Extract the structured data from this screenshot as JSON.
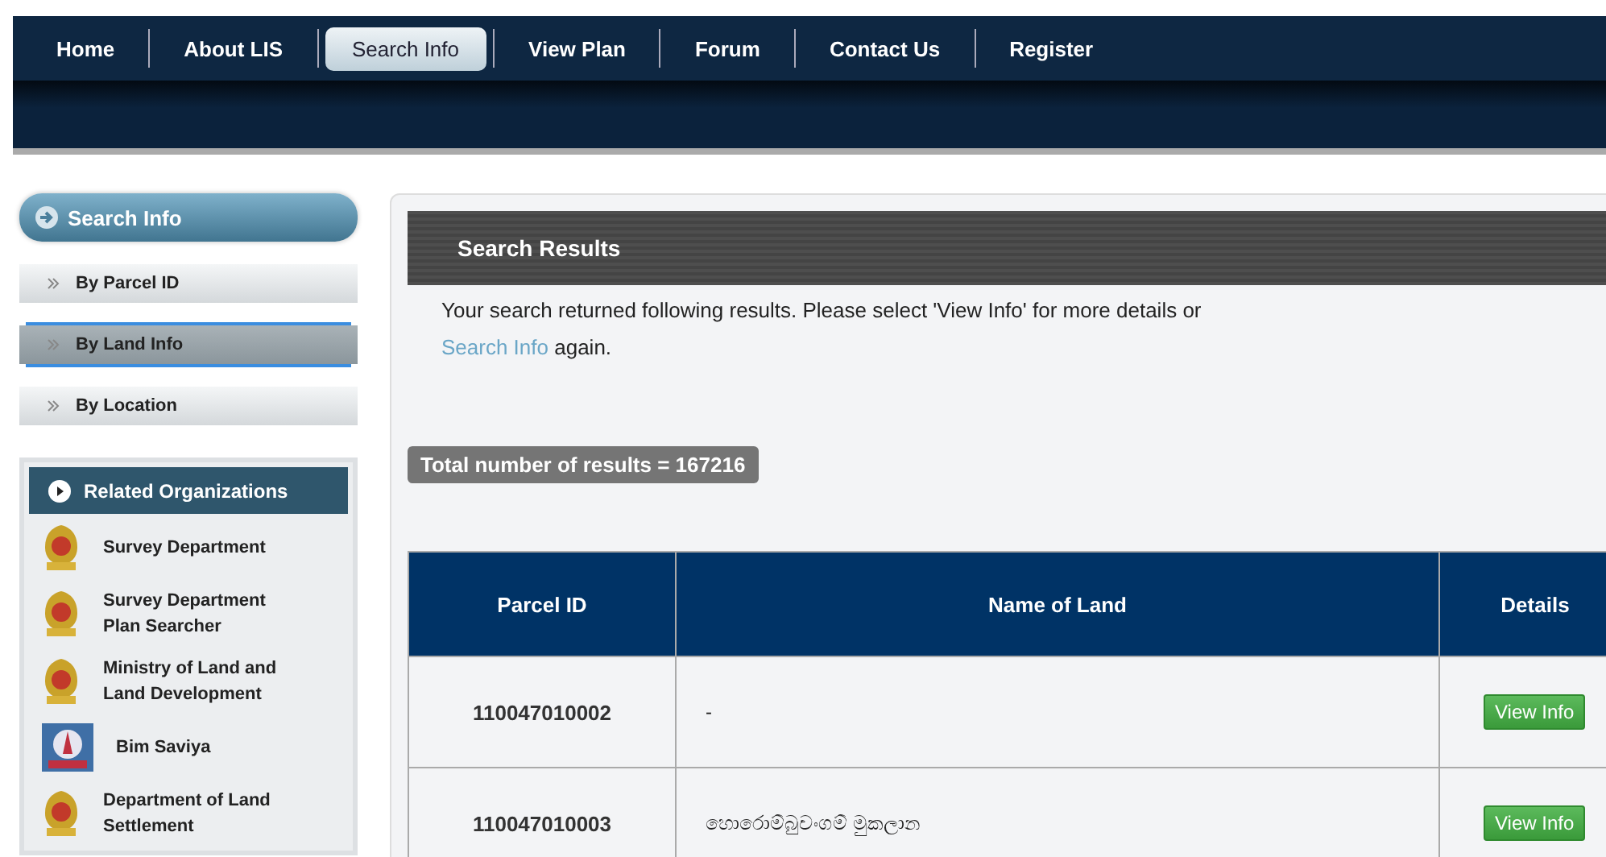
{
  "nav": [
    {
      "label": "Home",
      "selected": false
    },
    {
      "label": "About LIS",
      "selected": false
    },
    {
      "label": "Search Info",
      "selected": true
    },
    {
      "label": "View Plan",
      "selected": false
    },
    {
      "label": "Forum",
      "selected": false
    },
    {
      "label": "Contact Us",
      "selected": false
    },
    {
      "label": "Register",
      "selected": false
    }
  ],
  "sidebar": {
    "title": "Search Info",
    "items": [
      {
        "label": "By Parcel ID",
        "selected": false
      },
      {
        "label": "By Land Info",
        "selected": true
      },
      {
        "label": "By Location",
        "selected": false
      }
    ],
    "related": {
      "title": "Related Organizations",
      "items": [
        {
          "label": "Survey Department",
          "kind": "emblem"
        },
        {
          "label": "Survey Department Plan Searcher",
          "kind": "emblem"
        },
        {
          "label": "Ministry of Land and Land Development",
          "kind": "emblem"
        },
        {
          "label": "Bim Saviya",
          "kind": "logo"
        },
        {
          "label": "Department of Land Settlement",
          "kind": "emblem"
        }
      ]
    }
  },
  "results": {
    "title": "Search Results",
    "message": "Your search returned following results. Please select 'View Info' for more details or",
    "link": "Search Info",
    "message_end": "again.",
    "total": "Total number of results = 167216",
    "table": {
      "columns": [
        "Parcel ID",
        "Name of Land",
        "Details"
      ],
      "rows": [
        {
          "parcel_id": "110047010002",
          "name": "-",
          "action": "View Info"
        },
        {
          "parcel_id": "110047010003",
          "name": "හොරොම්බුවංගම් මුකලාන",
          "action": "View Info"
        }
      ]
    }
  }
}
